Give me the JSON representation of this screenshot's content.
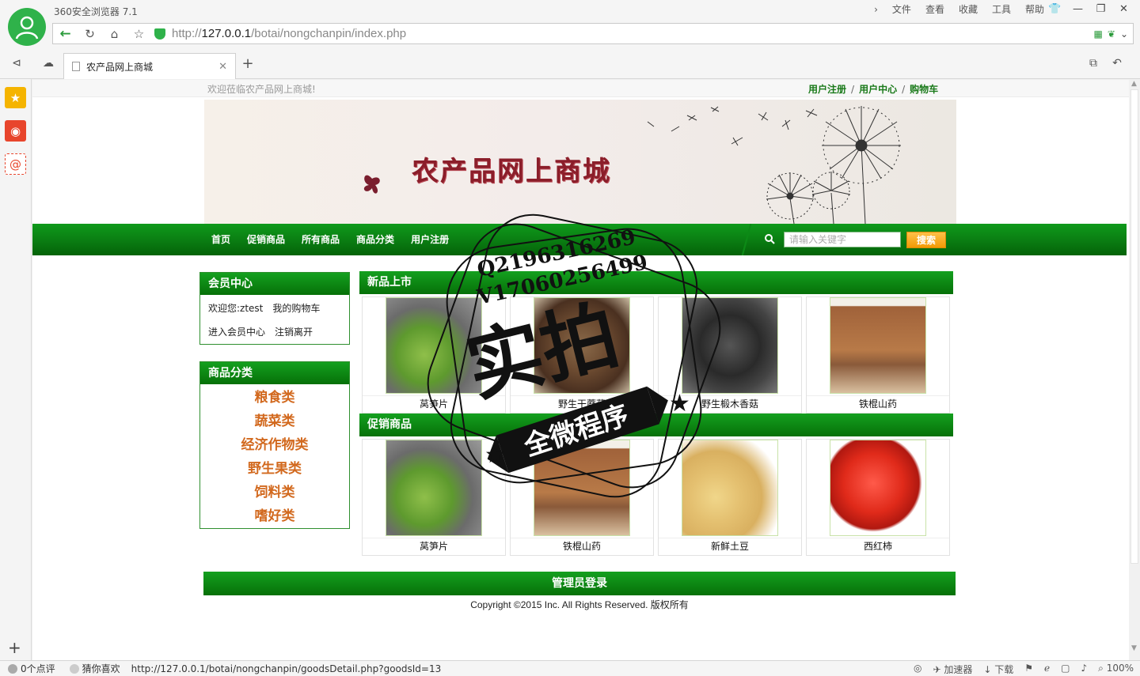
{
  "browser": {
    "title": "360安全浏览器 7.1",
    "menu": [
      "文件",
      "查看",
      "收藏",
      "工具",
      "帮助"
    ],
    "url_prefix": "http://",
    "url_host": "127.0.0.1",
    "url_path": "/botai/nongchanpin/index.php",
    "tab_title": "农产品网上商城",
    "status_comments": "0个点评",
    "status_guess": "猜你喜欢",
    "status_url": "http://127.0.0.1/botai/nongchanpin/goodsDetail.php?goodsId=13",
    "status_accelerator": "加速器",
    "status_download": "下载",
    "status_zoom": "100%"
  },
  "page": {
    "welcome": "欢迎莅临农产品网上商城!",
    "top_links": [
      "用户注册",
      "用户中心",
      "购物车"
    ],
    "banner_title": "农产品网上商城",
    "nav": [
      "首页",
      "促销商品",
      "所有商品",
      "商品分类",
      "用户注册"
    ],
    "search_placeholder": "请输入关键字",
    "search_button": "搜索",
    "member": {
      "title": "会员中心",
      "welcome_label": "欢迎您:",
      "username": "ztest",
      "cart": "我的购物车",
      "enter_center": "进入会员中心",
      "logout": "注销离开"
    },
    "categories": {
      "title": "商品分类",
      "items": [
        "粮食类",
        "蔬菜类",
        "经济作物类",
        "野生果类",
        "饲料类",
        "嗜好类"
      ]
    },
    "new_products": {
      "title": "新品上市",
      "items": [
        "莴笋片",
        "野生干蘑菇",
        "野生椴木香菇",
        "铁棍山药"
      ]
    },
    "promo_products": {
      "title": "促销商品",
      "items": [
        "莴笋片",
        "铁棍山药",
        "新鲜土豆",
        "西红柿"
      ]
    },
    "footer_admin": "管理员登录",
    "copyright": "Copyright ©2015 Inc. All Rights Reserved. 版权所有"
  },
  "watermark": {
    "line1": "Q2196316269",
    "line2": "V17060256499",
    "big": "实拍",
    "ribbon": "全微程序"
  },
  "colors": {
    "nav_green": "#0a7c12",
    "link_green": "#1a7a1a",
    "category_orange": "#d2691e",
    "search_orange": "#f39a05",
    "brand_green": "#2fb24a"
  }
}
